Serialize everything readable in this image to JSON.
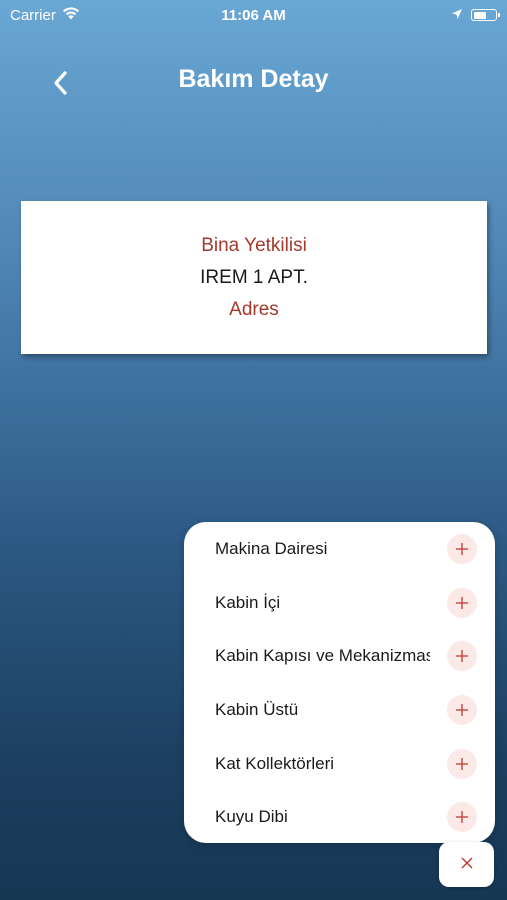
{
  "status_bar": {
    "carrier": "Carrier",
    "time": "11:06 AM",
    "battery_level": 0.6
  },
  "nav": {
    "title": "Bakım Detay",
    "back_icon": "chevron-left-icon"
  },
  "card": {
    "label1": "Bina Yetkilisi",
    "value": "IREM 1 APT.",
    "label2": "Adres"
  },
  "menu": {
    "items": [
      {
        "label": "Makina Dairesi"
      },
      {
        "label": "Kabin İçi"
      },
      {
        "label": "Kabin Kapısı ve Mekanizması"
      },
      {
        "label": "Kabin Üstü"
      },
      {
        "label": "Kat Kollektörleri"
      },
      {
        "label": "Kuyu Dibi"
      }
    ],
    "add_icon": "plus-icon",
    "close_icon": "close-icon"
  },
  "colors": {
    "accent": "#a33a2c",
    "plus_bg": "#fbe9e7",
    "plus_fg": "#c0392b",
    "gradient_top": "#69a7d4",
    "gradient_bottom": "#163754"
  }
}
